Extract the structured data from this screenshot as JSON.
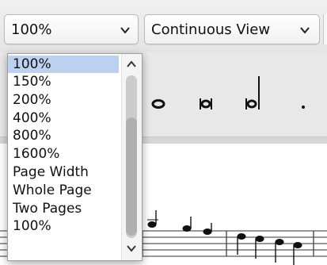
{
  "toolbar": {
    "zoom_value": "100%",
    "view_value": "Continuous View"
  },
  "zoom_menu": {
    "options": [
      "100%",
      "150%",
      "200%",
      "400%",
      "800%",
      "1600%",
      "Page Width",
      "Whole Page",
      "Two Pages",
      "100%"
    ],
    "selected_index": 0
  },
  "colors": {
    "selection": "#bcd1f0",
    "toolbar_bg": "#eceaea",
    "menu_bg": "#ffffff"
  },
  "icons": [
    "chevron-down-icon",
    "scroll-up-arrow-icon",
    "scroll-down-arrow-icon",
    "whole-note-icon",
    "breve-note-icon",
    "half-note-icon",
    "dot-icon"
  ]
}
